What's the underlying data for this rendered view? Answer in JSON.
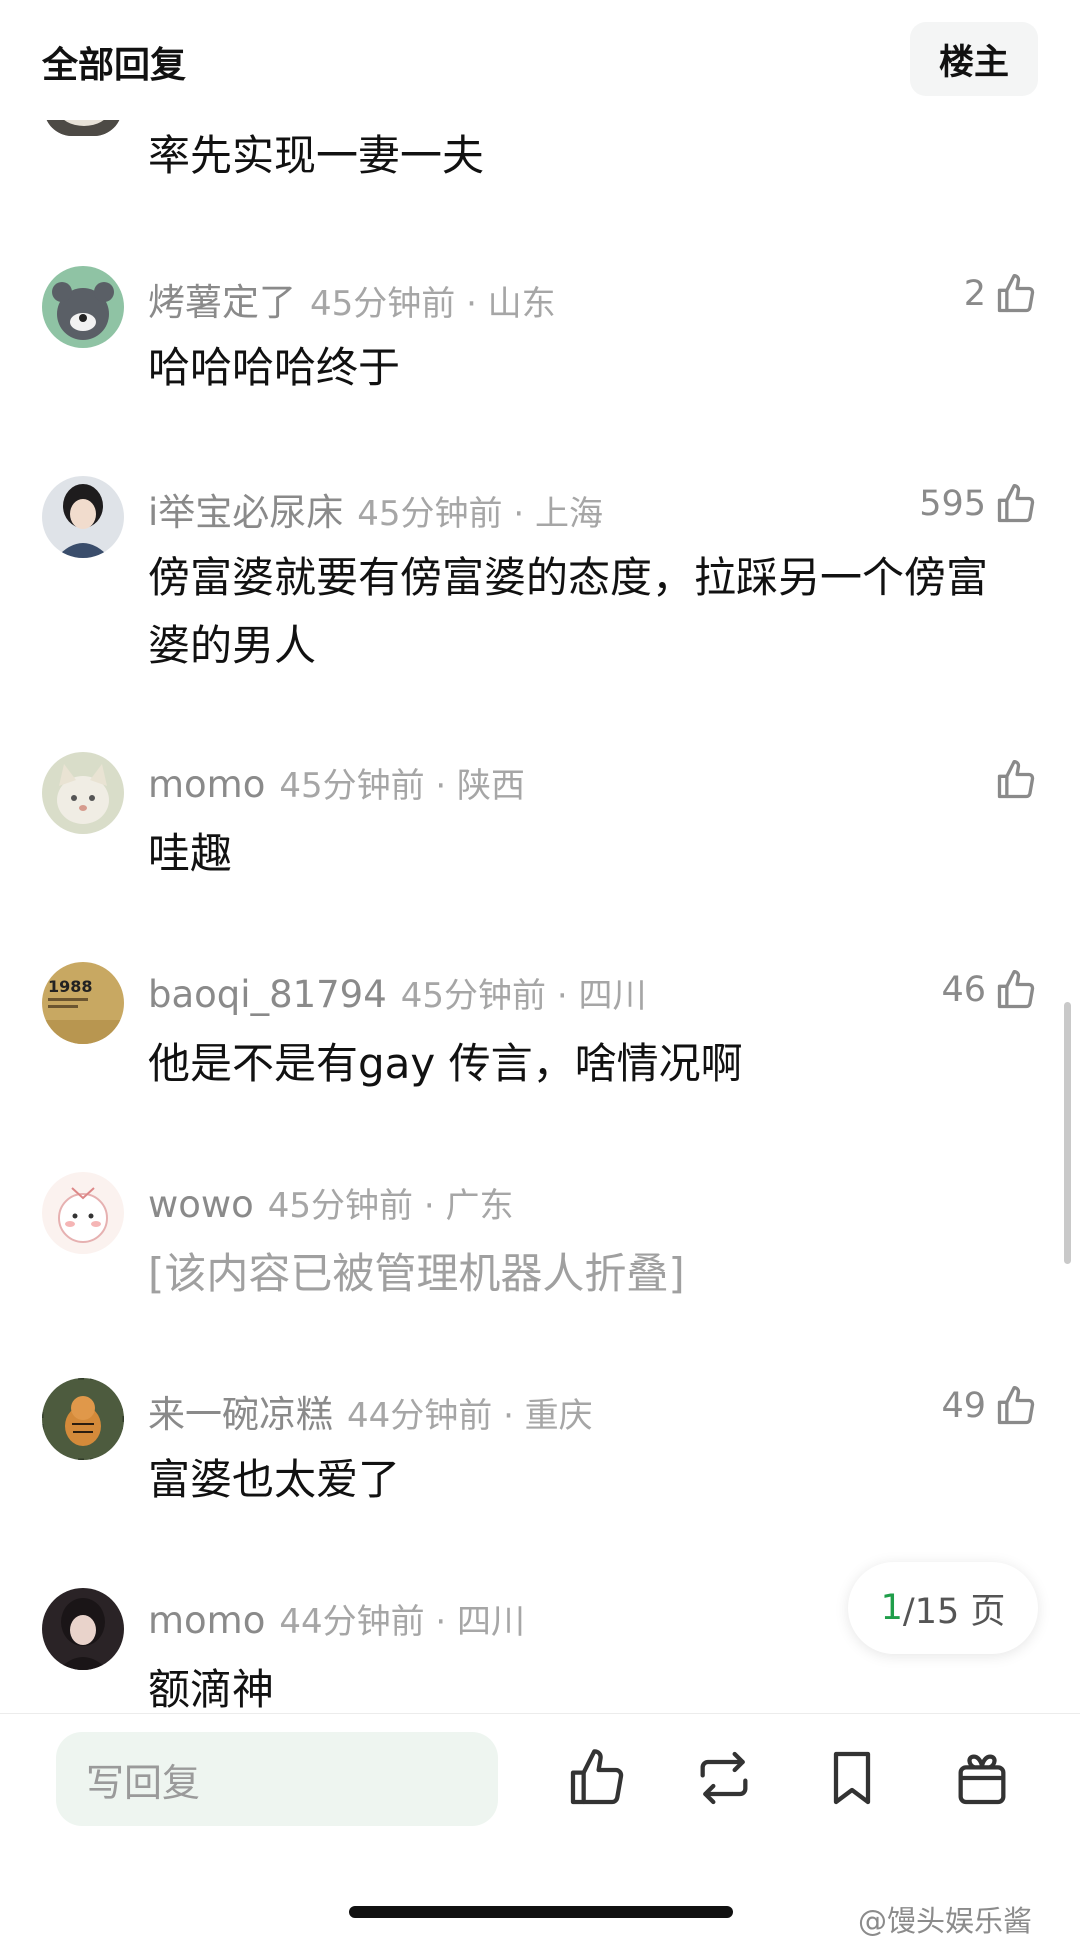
{
  "header": {
    "title": "全部回复",
    "owner_button": "楼主"
  },
  "first_comment": {
    "text": "率先实现一妻一夫"
  },
  "comments": [
    {
      "username": "烤薯定了",
      "time_location": "45分钟前 · 山东",
      "likes": "2",
      "text": "哈哈哈哈终于"
    },
    {
      "username": "i举宝必尿床",
      "time_location": "45分钟前 · 上海",
      "likes": "595",
      "text": "傍富婆就要有傍富婆的态度，拉踩另一个傍富婆的男人"
    },
    {
      "username": "momo",
      "time_location": "45分钟前 · 陕西",
      "likes": "",
      "text": "哇趣"
    },
    {
      "username": "baoqi_81794",
      "time_location": "45分钟前 · 四川",
      "likes": "46",
      "text": "他是不是有gay 传言，啥情况啊"
    },
    {
      "username": "wowo",
      "time_location": "45分钟前 · 广东",
      "likes": "",
      "text": "[该内容已被管理机器人折叠]"
    },
    {
      "username": "来一碗凉糕",
      "time_location": "44分钟前 · 重庆",
      "likes": "49",
      "text": "富婆也太爱了"
    },
    {
      "username": "momo",
      "time_location": "44分钟前 · 四川",
      "likes": "",
      "text": "额滴神"
    }
  ],
  "avatar_badges": {
    "baoqi": "1988"
  },
  "pagination": {
    "current": "1",
    "total_text": "/15 页"
  },
  "bottom_bar": {
    "reply_placeholder": "写回复",
    "icons": [
      "thumbs-up-icon",
      "repost-icon",
      "bookmark-icon",
      "gift-icon"
    ]
  },
  "watermark": "@馒头娱乐酱",
  "colors": {
    "accent_green": "#1f9e4a",
    "input_bg": "#eef5f0",
    "muted_text": "#8a8a8a"
  }
}
